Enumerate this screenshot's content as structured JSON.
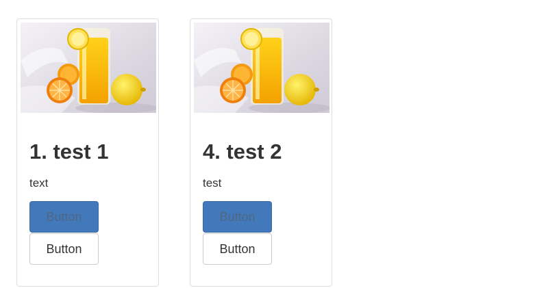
{
  "cards": [
    {
      "title": "1. test 1",
      "text": "text",
      "primary_button_label": "Button",
      "secondary_button_label": "Button",
      "image": "orange-juice-photo"
    },
    {
      "title": "4. test 2",
      "text": "test",
      "primary_button_label": "Button",
      "secondary_button_label": "Button",
      "image": "orange-juice-photo"
    }
  ],
  "colors": {
    "primary_button": "#4279ba",
    "card_border": "#dddddd",
    "text": "#333333"
  }
}
